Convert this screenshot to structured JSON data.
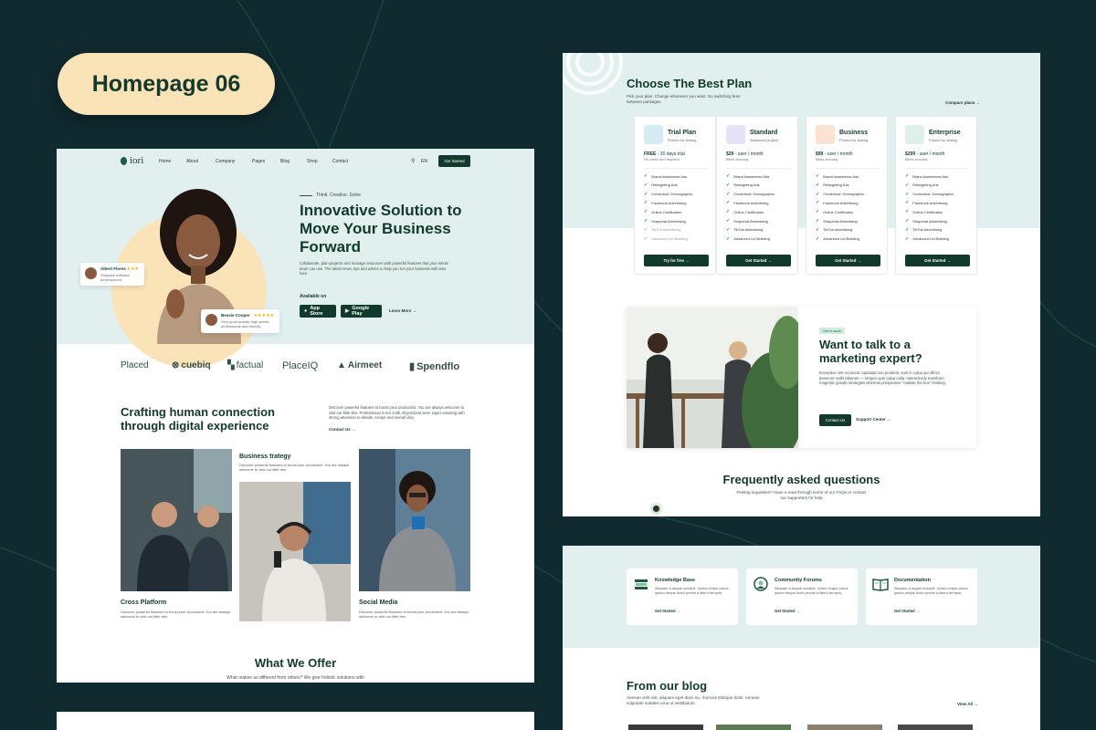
{
  "badge": "Homepage 06",
  "home": {
    "logo": "iori",
    "nav": [
      "Home",
      "About",
      "Company",
      "Pages",
      "Blog",
      "Shop",
      "Contact"
    ],
    "lang": "EN",
    "cta": "Get Started",
    "tagline": "Think. Creative. Solve",
    "title": "Innovative Solution to Move Your Business Forward",
    "text": "Collaborate, plan projects and manage resources with powerful features that your whole team can use. The latest news, tips and advice to help you run your business with less fuss.",
    "available": "Available on",
    "app_store": "App Store",
    "google_play": "Google Play",
    "learn_more": "Learn More",
    "cards": [
      {
        "name": "Albert Flores",
        "text": "Sharpsie software development."
      },
      {
        "name": "Bessie Cooper",
        "text": "Very good quality, high speed, professional and friendly."
      }
    ],
    "brands": [
      "Placed",
      "cuebiq",
      "factual",
      "PlaceIQ",
      "Airmeet",
      "Spendflo"
    ],
    "section_title": "Crafting human connection through digital experience",
    "section_text": "Discover powerful features to boost your productivit. You are always welcome to visit our little den. Professional in teir craft! All products were super amazing with strong attension to details, comps and overall vibe.",
    "contact_us": "Contact Us",
    "columns": [
      {
        "title": "Cross Platform",
        "text": "Discover powerful features to boost your productivit. You are always welcome to visit our little den."
      },
      {
        "title": "Business trategy",
        "text": "Discover powerful features to boost your productivit. You are always welcome to visit our little den."
      },
      {
        "title": "Social Media",
        "text": "Discover powerful features to boost your productivit. You are always welcome to visit our little den."
      }
    ],
    "offer_title": "What We Offer",
    "offer_sub": "What makes us different from others? We give holistic solutions with"
  },
  "pricing": {
    "title": "Choose The Best Plan",
    "sub": "Pick your plan. Change whenever you want. No switching fees between packages",
    "compare": "Compare plans",
    "features": [
      "Brand Awareness Ads",
      "Retargeting Ads",
      "Contextual, Demographic",
      "Facebook Advertising",
      "Online Certificates",
      "Snapchat Advertising",
      "TikTok Advertising",
      "Advanced Lid Building"
    ],
    "plans": [
      {
        "name": "Trial Plan",
        "desc": "Protect for testing",
        "price": "FREE",
        "unit": " - 30 days trial",
        "note": "No credit card required",
        "button": "Try for free",
        "icon_bg": "#d6ecf3",
        "enabled": 6
      },
      {
        "name": "Standard",
        "desc": "Advanced project",
        "price": "$29",
        "unit": " - user / month",
        "note": "Billed annually",
        "button": "Get Started",
        "icon_bg": "#e6e3f6",
        "enabled": 8
      },
      {
        "name": "Business",
        "desc": "Protect for testing",
        "price": "$99",
        "unit": " - user / month",
        "note": "Billed annually",
        "button": "Get Started",
        "icon_bg": "#fbe3d2",
        "enabled": 8
      },
      {
        "name": "Enterprise",
        "desc": "Protect for testing",
        "price": "$299",
        "unit": " - user / month",
        "note": "Billed annually",
        "button": "Get Started",
        "icon_bg": "#dff0e8",
        "enabled": 8
      }
    ]
  },
  "expert": {
    "badge": "Get in touch",
    "title": "Want to talk to a marketing expert?",
    "text": "Excepteur sint occaecat cupidatat non proident, sunt in culpa qui officia deserunt mollit laborum — tempor quis culpa nulla. Interactively transform magnetic growth strategies whereas prospective \"outside the box\" thinking.",
    "button": "Contact Us",
    "link": "Support Center"
  },
  "faq": {
    "title": "Frequently asked questions",
    "sub": "Feeling inquisitive? Have a read through some of our FAQs or contact our supporters for help"
  },
  "help": [
    {
      "title": "Knowledge Base",
      "text": "Aliquam a augue suscipit, luctus neque purus ipsum neque dolor primis a libero tempus.",
      "link": "Get Started"
    },
    {
      "title": "Community Forums",
      "text": "Aliquam a augue suscipit, luctus neque purus ipsum neque dolor primis a libero tempus.",
      "link": "Get Started"
    },
    {
      "title": "Documentation",
      "text": "Aliquam a augue suscipit, luctus neque purus ipsum neque dolor primis a libero tempus.",
      "link": "Get Started"
    }
  ],
  "blog": {
    "title": "From our blog",
    "sub": "Aenean velit nisl, aliquam eget diam eu, rhoncus tristique dolor. Aenean vulputate sodales urna ut vestibulum",
    "view_all": "View All"
  }
}
